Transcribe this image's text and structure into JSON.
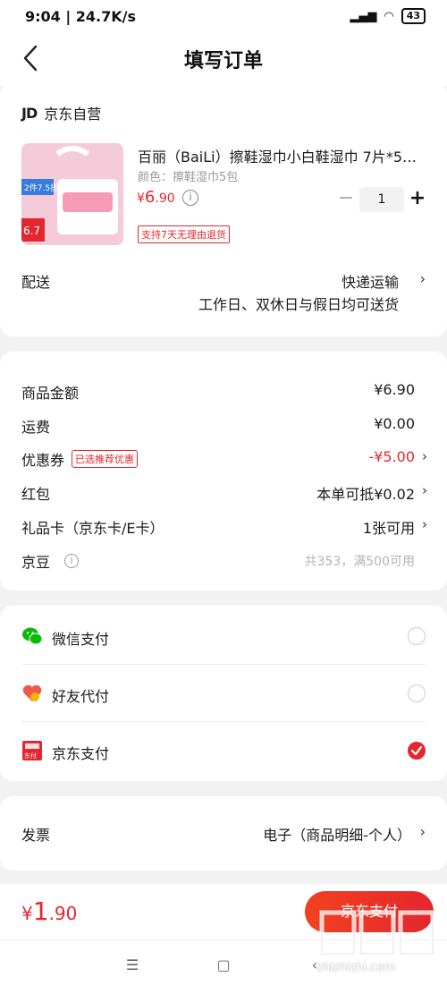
{
  "status_bar": {
    "time": "9:04",
    "network_speed": "24.7K/s",
    "battery": "43"
  },
  "header": {
    "title": "填写订单"
  },
  "store": {
    "logo_text": "JD",
    "name": "京东自营"
  },
  "product": {
    "name": "百丽（BaiLi）擦鞋湿巾小白鞋湿巾 7片*5…",
    "spec": "颜色：擦鞋湿巾5包",
    "price_symbol": "¥",
    "price_int": "6",
    "price_dec": ".90",
    "quantity": "1",
    "minus": "−",
    "plus": "+",
    "return_tag": "支持7天无理由退货",
    "image_text_1": "2件7.5折",
    "image_text_2": "6.7"
  },
  "delivery": {
    "label": "配送",
    "value": "快递运输",
    "sub": "工作日、双休日与假日均可送货"
  },
  "summary": {
    "goods_amount": {
      "label": "商品金额",
      "value": "¥6.90"
    },
    "shipping": {
      "label": "运费",
      "value": "¥0.00"
    },
    "coupon": {
      "label": "优惠券",
      "tag": "已选推荐优惠",
      "value": "-¥5.00"
    },
    "red_packet": {
      "label": "红包",
      "value": "本单可抵¥0.02"
    },
    "gift_card": {
      "label": "礼品卡（京东卡/E卡）",
      "value": "1张可用"
    },
    "jd_beans": {
      "label": "京豆",
      "value": "共353，满500可用"
    }
  },
  "payment": {
    "wechat": {
      "label": "微信支付",
      "checked": false
    },
    "friend": {
      "label": "好友代付",
      "checked": false
    },
    "jdpay": {
      "label": "京东支付",
      "checked": true,
      "icon_text": "东付"
    }
  },
  "invoice": {
    "label": "发票",
    "value": "电子（商品明细-个人）"
  },
  "bottom": {
    "total_symbol": "¥",
    "total_int": "1",
    "total_dec": ".90",
    "pay_button": "京东支付"
  },
  "watermark": {
    "text": "zhizhizhi.com"
  },
  "colors": {
    "accent": "#e4272e",
    "wechat_green": "#09bb07"
  }
}
